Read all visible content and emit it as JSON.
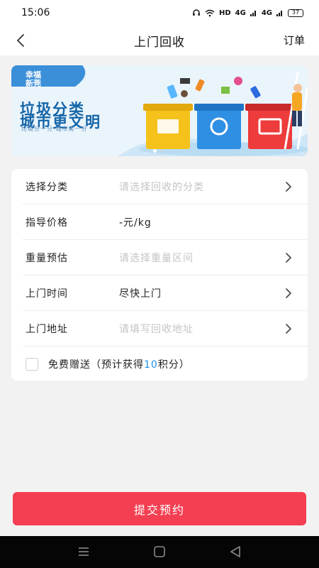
{
  "status_bar": {
    "time": "15:06",
    "network": "HD",
    "signal_1": "4G",
    "signal_2": "4G",
    "battery": "37"
  },
  "nav": {
    "title": "上门回收",
    "orders_label": "订单"
  },
  "banner": {
    "tag_line1": "幸福",
    "tag_line2": "新莞",
    "headline_line1": "垃圾分类",
    "headline_line2": "城市更文明",
    "subtitle": "垃圾分一分  城市美一分",
    "slides": 2,
    "active_slide": 1,
    "bin_colors": [
      "#f5c21b",
      "#2f8fe3",
      "#ee3b3b"
    ]
  },
  "form": {
    "rows": [
      {
        "label": "选择分类",
        "value": "请选择回收的分类",
        "is_placeholder": true,
        "has_arrow": true
      },
      {
        "label": "指导价格",
        "value": "-元/kg",
        "is_placeholder": false,
        "has_arrow": false
      },
      {
        "label": "重量预估",
        "value": "请选择重量区间",
        "is_placeholder": true,
        "has_arrow": true
      },
      {
        "label": "上门时间",
        "value": "尽快上门",
        "is_placeholder": false,
        "has_arrow": true
      },
      {
        "label": "上门地址",
        "value": "请填写回收地址",
        "is_placeholder": true,
        "has_arrow": true
      }
    ],
    "free_gift": {
      "checked": false,
      "text_before": "免费赠送（预计获得",
      "points": "10",
      "text_after": "积分）"
    }
  },
  "submit_label": "提交预约",
  "colors": {
    "accent": "#f43f52",
    "points": "#1f8fe6",
    "placeholder": "#c4c4c4"
  }
}
